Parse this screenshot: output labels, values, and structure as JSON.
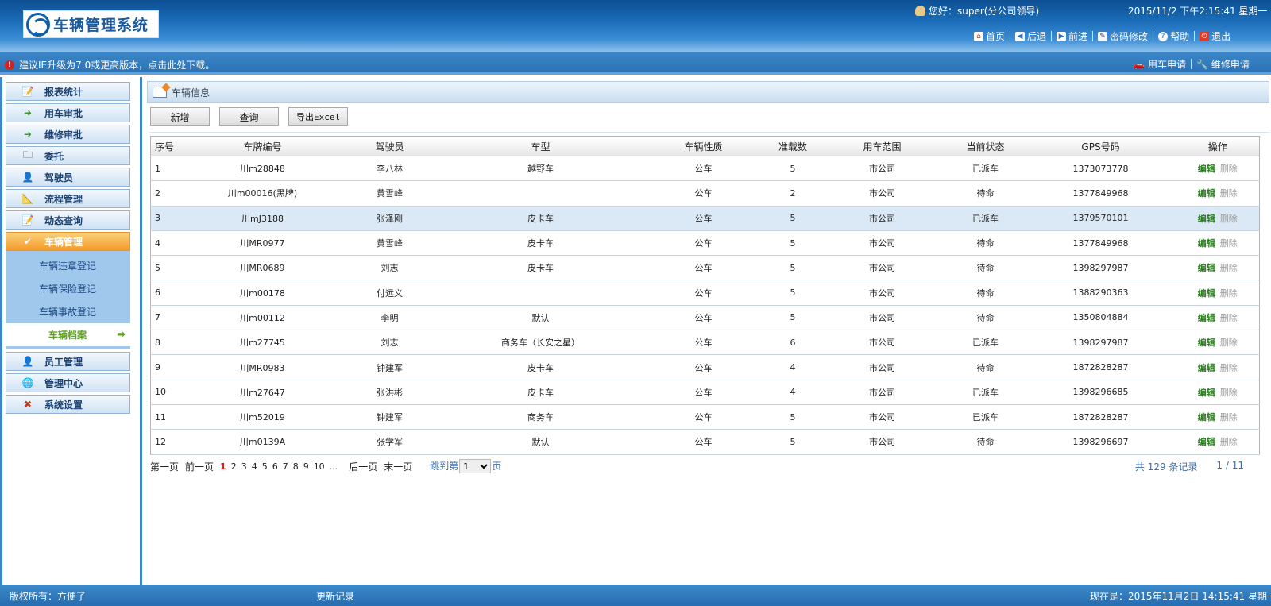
{
  "header": {
    "logo_text": "车辆管理系统",
    "welcome": "您好：super(分公司领导)",
    "clock": "2015/11/2 下午2:15:41 星期一",
    "nav": [
      {
        "label": "首页",
        "icon": "home-icon"
      },
      {
        "label": "后退",
        "icon": "back-icon"
      },
      {
        "label": "前进",
        "icon": "forward-icon"
      },
      {
        "label": "密码修改",
        "icon": "key-icon"
      },
      {
        "label": "帮助",
        "icon": "help-icon"
      },
      {
        "label": "退出",
        "icon": "exit-icon"
      }
    ]
  },
  "notice": {
    "text": "建议IE升级为7.0或更高版本，点击此处下载。",
    "quick": [
      {
        "label": "用车申请",
        "icon": "car-request-icon"
      },
      {
        "label": "维修申请",
        "icon": "repair-request-icon"
      }
    ]
  },
  "sidebar": {
    "items": [
      {
        "label": "报表统计",
        "icon": "report-icon"
      },
      {
        "label": "用车审批",
        "icon": "approve-arrow-icon"
      },
      {
        "label": "维修审批",
        "icon": "repair-arrow-icon"
      },
      {
        "label": "委托",
        "icon": "folder-icon"
      },
      {
        "label": "驾驶员",
        "icon": "driver-icon"
      },
      {
        "label": "流程管理",
        "icon": "ruler-icon"
      },
      {
        "label": "动态查询",
        "icon": "edit-icon"
      },
      {
        "label": "车辆管理",
        "icon": "check-icon"
      },
      {
        "label": "员工管理",
        "icon": "staff-icon"
      },
      {
        "label": "管理中心",
        "icon": "globe-icon"
      },
      {
        "label": "系统设置",
        "icon": "tools-icon"
      }
    ],
    "subitems": [
      "车辆违章登记",
      "车辆保险登记",
      "车辆事故登记",
      "车辆档案"
    ],
    "selected_subitem": "车辆档案"
  },
  "content": {
    "breadcrumb": "车辆信息",
    "buttons": {
      "add": "新增",
      "query": "查询",
      "export": "导出Excel"
    },
    "columns": [
      "序号",
      "车牌编号",
      "驾驶员",
      "车型",
      "车辆性质",
      "准载数",
      "用车范围",
      "当前状态",
      "GPS号码",
      "操作"
    ],
    "rows": [
      {
        "no": "1",
        "plate": "川m28848",
        "driver": "李八林",
        "model": "越野车",
        "nature": "公车",
        "seats": "5",
        "scope": "市公司",
        "status": "已派车",
        "gps": "1373073778"
      },
      {
        "no": "2",
        "plate": "川m00016(黑牌)",
        "driver": "黄雪峰",
        "model": "",
        "nature": "公车",
        "seats": "2",
        "scope": "市公司",
        "status": "待命",
        "gps": "1377849968"
      },
      {
        "no": "3",
        "plate": "川mJ3188",
        "driver": "张泽刚",
        "model": "皮卡车",
        "nature": "公车",
        "seats": "5",
        "scope": "市公司",
        "status": "已派车",
        "gps": "1379570101"
      },
      {
        "no": "4",
        "plate": "川MR0977",
        "driver": "黄雪峰",
        "model": "皮卡车",
        "nature": "公车",
        "seats": "5",
        "scope": "市公司",
        "status": "待命",
        "gps": "1377849968"
      },
      {
        "no": "5",
        "plate": "川MR0689",
        "driver": "刘志",
        "model": "皮卡车",
        "nature": "公车",
        "seats": "5",
        "scope": "市公司",
        "status": "待命",
        "gps": "1398297987"
      },
      {
        "no": "6",
        "plate": "川m00178",
        "driver": "付远义",
        "model": "",
        "nature": "公车",
        "seats": "5",
        "scope": "市公司",
        "status": "待命",
        "gps": "1388290363"
      },
      {
        "no": "7",
        "plate": "川m00112",
        "driver": "李明",
        "model": "默认",
        "nature": "公车",
        "seats": "5",
        "scope": "市公司",
        "status": "待命",
        "gps": "1350804884"
      },
      {
        "no": "8",
        "plate": "川m27745",
        "driver": "刘志",
        "model": "商务车（长安之星）",
        "nature": "公车",
        "seats": "6",
        "scope": "市公司",
        "status": "已派车",
        "gps": "1398297987"
      },
      {
        "no": "9",
        "plate": "川MR0983",
        "driver": "钟建军",
        "model": "皮卡车",
        "nature": "公车",
        "seats": "4",
        "scope": "市公司",
        "status": "待命",
        "gps": "1872828287"
      },
      {
        "no": "10",
        "plate": "川m27647",
        "driver": "张洪彬",
        "model": "皮卡车",
        "nature": "公车",
        "seats": "4",
        "scope": "市公司",
        "status": "已派车",
        "gps": "1398296685"
      },
      {
        "no": "11",
        "plate": "川m52019",
        "driver": "钟建军",
        "model": "商务车",
        "nature": "公车",
        "seats": "5",
        "scope": "市公司",
        "status": "已派车",
        "gps": "1872828287"
      },
      {
        "no": "12",
        "plate": "川m0139A",
        "driver": "张学军",
        "model": "默认",
        "nature": "公车",
        "seats": "5",
        "scope": "市公司",
        "status": "待命",
        "gps": "1398296697"
      }
    ],
    "row_actions": {
      "edit": "编辑",
      "delete": "删除"
    },
    "status_colors": {
      "已派车": "#2a7d1e",
      "待命": "#c71b1b"
    },
    "pager": {
      "first": "第一页",
      "prev": "前一页",
      "next": "后一页",
      "last": "末一页",
      "pages": [
        "1",
        "2",
        "3",
        "4",
        "5",
        "6",
        "7",
        "8",
        "9",
        "10",
        "..."
      ],
      "current": "1",
      "jump_prefix": "跳到第",
      "jump_suffix": "页",
      "jump_value": "1",
      "total": "共 129 条记录",
      "page_info": "1 / 11"
    }
  },
  "footer": {
    "copyright": "版权所有：方便了",
    "changelog": "更新记录",
    "now": "现在是：2015年11月2日 14:15:41 星期一"
  }
}
